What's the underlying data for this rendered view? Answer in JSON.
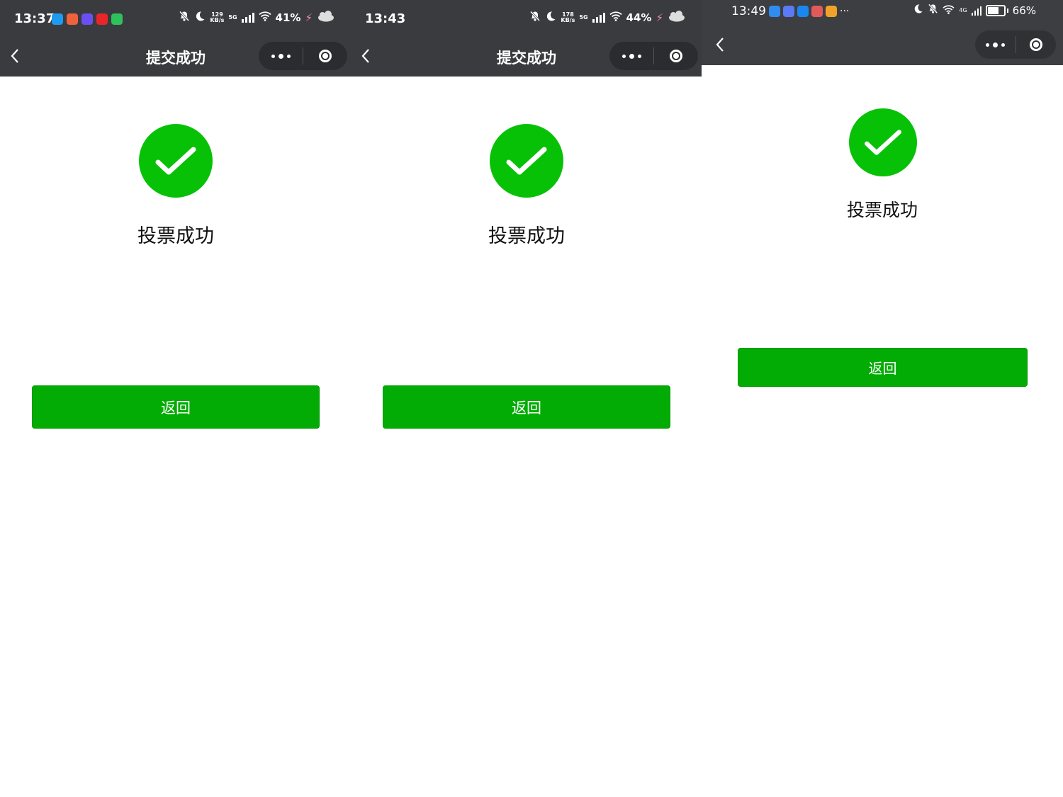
{
  "screens": [
    {
      "status": {
        "time": "13:37",
        "net_speed": "129",
        "net_unit": "KB/s",
        "net_type": "5G",
        "battery": "41%"
      },
      "nav": {
        "title": "提交成功"
      },
      "result": {
        "message": "投票成功"
      },
      "button": {
        "label": "返回"
      }
    },
    {
      "status": {
        "time": "13:43",
        "net_speed": "178",
        "net_unit": "KB/s",
        "net_type": "5G",
        "battery": "44%"
      },
      "nav": {
        "title": "提交成功"
      },
      "result": {
        "message": "投票成功"
      },
      "button": {
        "label": "返回"
      }
    },
    {
      "status": {
        "time": "13:49",
        "more": "···",
        "net_type": "4G",
        "battery": "66%"
      },
      "nav": {
        "title": ""
      },
      "result": {
        "message": "投票成功"
      },
      "button": {
        "label": "返回"
      }
    }
  ],
  "icons": {
    "back": "chevron-left-icon",
    "more": "more-dots-icon",
    "close": "target-close-icon",
    "success": "checkmark-circle-icon",
    "mute": "bell-off-icon",
    "dnd": "moon-icon",
    "wifi": "wifi-icon",
    "signal": "signal-icon"
  },
  "colors": {
    "topbar": "#3a3b3f",
    "success_green": "#07c107",
    "button_green": "#03ac04",
    "text": "#111111"
  }
}
